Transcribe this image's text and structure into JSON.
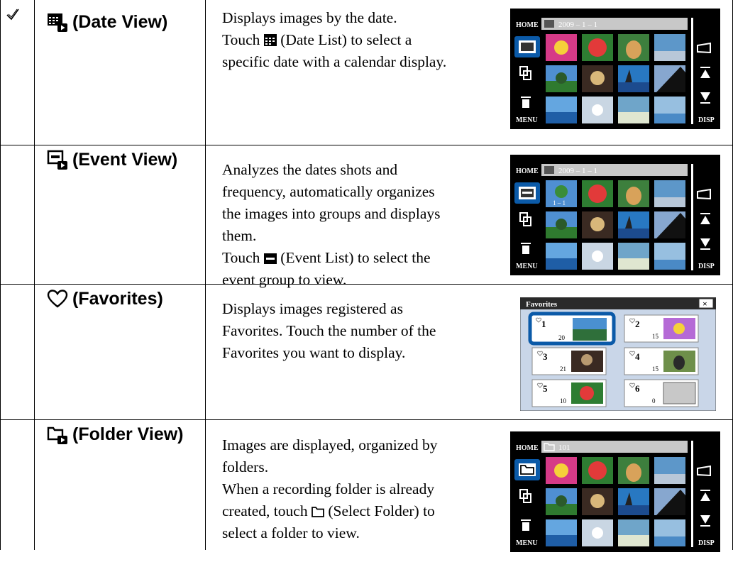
{
  "rows": [
    {
      "id": "date-view",
      "checked": true,
      "title": "(Date View)",
      "icon": "date-view-icon",
      "desc_lines": [
        "Displays images by the date.",
        "Touch ",
        " (Date List) to select a",
        "specific date with a calendar display."
      ],
      "screen": {
        "home": "HOME",
        "header": "2009 – 1 – 1",
        "menu": "MENU",
        "disp": "DISP"
      }
    },
    {
      "id": "event-view",
      "checked": false,
      "title": "(Event View)",
      "icon": "event-view-icon",
      "desc_lines": [
        "Analyzes the dates shots and",
        "frequency, automatically organizes",
        "the images into groups and displays",
        "them.",
        "Touch ",
        " (Event List) to select the",
        "event group to view."
      ],
      "screen": {
        "home": "HOME",
        "header": "2009 – 1 – 1",
        "tag": "1 – 1",
        "menu": "MENU",
        "disp": "DISP"
      }
    },
    {
      "id": "favorites",
      "checked": false,
      "title": "(Favorites)",
      "icon": "heart-icon",
      "desc_lines": [
        "Displays images registered as",
        "Favorites. Touch the number of the",
        "Favorites you want to display."
      ],
      "screen": {
        "title": "Favorites",
        "close": "×",
        "slots": [
          {
            "num": "1",
            "count": "20"
          },
          {
            "num": "2",
            "count": "15"
          },
          {
            "num": "3",
            "count": "21"
          },
          {
            "num": "4",
            "count": "15"
          },
          {
            "num": "5",
            "count": "10"
          },
          {
            "num": "6",
            "count": "0"
          }
        ]
      }
    },
    {
      "id": "folder-view",
      "checked": false,
      "title": "(Folder View)",
      "icon": "folder-view-icon",
      "desc_lines": [
        "Images are displayed, organized by",
        "folders.",
        "When a recording folder is already",
        "created, touch ",
        " (Select Folder) to",
        "select a folder to view."
      ],
      "screen": {
        "home": "HOME",
        "header": "101",
        "menu": "MENU",
        "disp": "DISP"
      }
    }
  ],
  "colors": {
    "screen_bg": "#000000",
    "highlight": "#0b5aa8",
    "favorites_bg": "#c9d6e8"
  }
}
